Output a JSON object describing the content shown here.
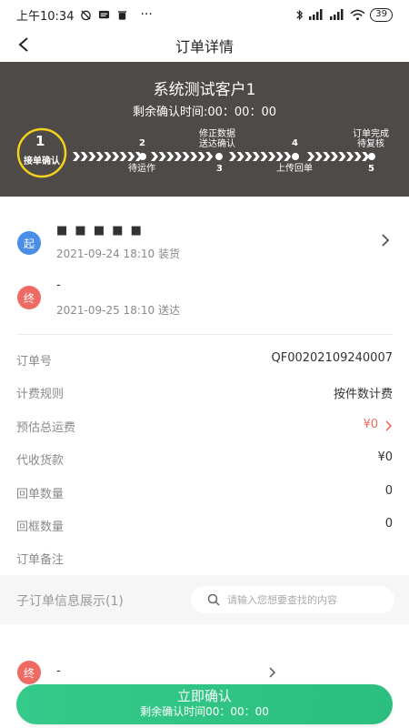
{
  "status_bar": {
    "time": "上午10:34",
    "battery": "39"
  },
  "nav": {
    "title": "订单详情"
  },
  "hero": {
    "customer": "系统测试客户1",
    "countdown": "剩余确认时间:00：00：00",
    "steps": [
      {
        "num": "1",
        "label": "接单确认"
      },
      {
        "num": "2",
        "label": "待运作"
      },
      {
        "num": "3",
        "label_l1": "修正数据",
        "label_l2": "送达确认"
      },
      {
        "num": "4",
        "label": "上传回单"
      },
      {
        "num": "5",
        "label_l1": "订单完成",
        "label_l2": "待复核"
      }
    ],
    "current_step": 1
  },
  "route": {
    "start_badge": "起",
    "start_address": "■ ■ ■ ■ ■",
    "start_time": "2021-09-24 18:10 装货",
    "end_badge": "终",
    "end_address": "-",
    "end_time": "2021-09-25 18:10 送达"
  },
  "info": [
    {
      "label": "订单号",
      "value": "QF00202109240007"
    },
    {
      "label": "计费规则",
      "value": "按件数计费"
    },
    {
      "label": "预估总运费",
      "value": "¥0"
    },
    {
      "label": "代收货款",
      "value": "¥0"
    },
    {
      "label": "回单数量",
      "value": "0"
    },
    {
      "label": "回框数量",
      "value": "0"
    },
    {
      "label": "订单备注",
      "value": ""
    }
  ],
  "suborder": {
    "title": "子订单信息展示(1)",
    "search_placeholder": "请输入您想要查找的内容",
    "items": [
      {
        "badge": "终",
        "text": "-"
      }
    ]
  },
  "confirm": {
    "label": "立即确认",
    "sub": "剩余确认时间00：00：00"
  },
  "colors": {
    "hero_bg": "#4d4a48",
    "active_step": "#f2d21c",
    "start_badge": "#4a8ee8",
    "end_badge": "#ee6b63",
    "confirm_button": "#35c98a",
    "price_red": "#ee6b63"
  }
}
